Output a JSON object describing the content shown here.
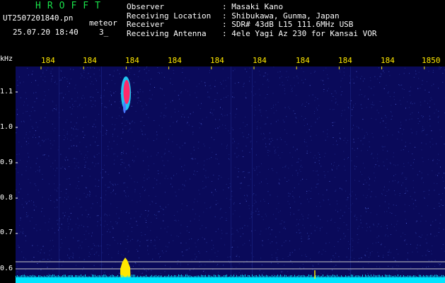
{
  "header": {
    "app_title": "HROFFT",
    "filename": "UT2507201840.pn",
    "datetime": "25.07.20 18:40",
    "meteor_label": "meteor",
    "count": "3_",
    "info": [
      {
        "label": "Observer",
        "value": ": Masaki Kano"
      },
      {
        "label": "Receiving Location",
        "value": ": Shibukawa, Gunma, Japan"
      },
      {
        "label": "Receiver",
        "value": ": SDR# 43dB L15 111.6MHz USB"
      },
      {
        "label": "Receiving Antenna",
        "value": ": 4ele Yagi Az 230 for Kansai VOR"
      }
    ]
  },
  "axes": {
    "y_unit": "kHz",
    "x_ticks": [
      "184",
      "184",
      "184",
      "184",
      "184",
      "184",
      "184",
      "184",
      "184",
      "1850"
    ],
    "y_ticks": [
      "1.1",
      "1.0",
      "0.9",
      "0.8",
      "0.7",
      "0.6"
    ]
  },
  "colors": {
    "background": "#0a0a5a",
    "noise": "#2a3aa0",
    "signal": "#ff2a6a",
    "signal_edge": "#22d8ff",
    "baseline": "#00e5ff",
    "burst": "#ffe800",
    "tick": "#ffe800"
  }
}
